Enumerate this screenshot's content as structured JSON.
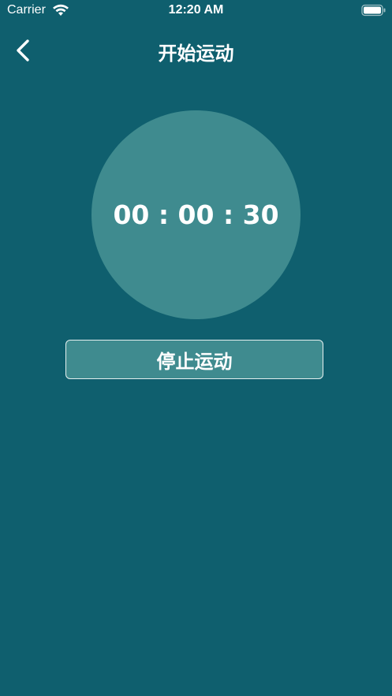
{
  "status_bar": {
    "carrier": "Carrier",
    "time": "12:20 AM",
    "icons": [
      "wifi-icon",
      "battery-icon"
    ]
  },
  "nav": {
    "title": "开始运动",
    "back_icon": "chevron-left-icon"
  },
  "timer": {
    "display": "00 : 00 : 30"
  },
  "actions": {
    "stop_label": "停止运动"
  },
  "colors": {
    "background": "#0f5f6e",
    "circle": "#3f8b8f",
    "button": "#3f8b8f",
    "button_border": "#e6f0f0",
    "text": "#ffffff"
  }
}
